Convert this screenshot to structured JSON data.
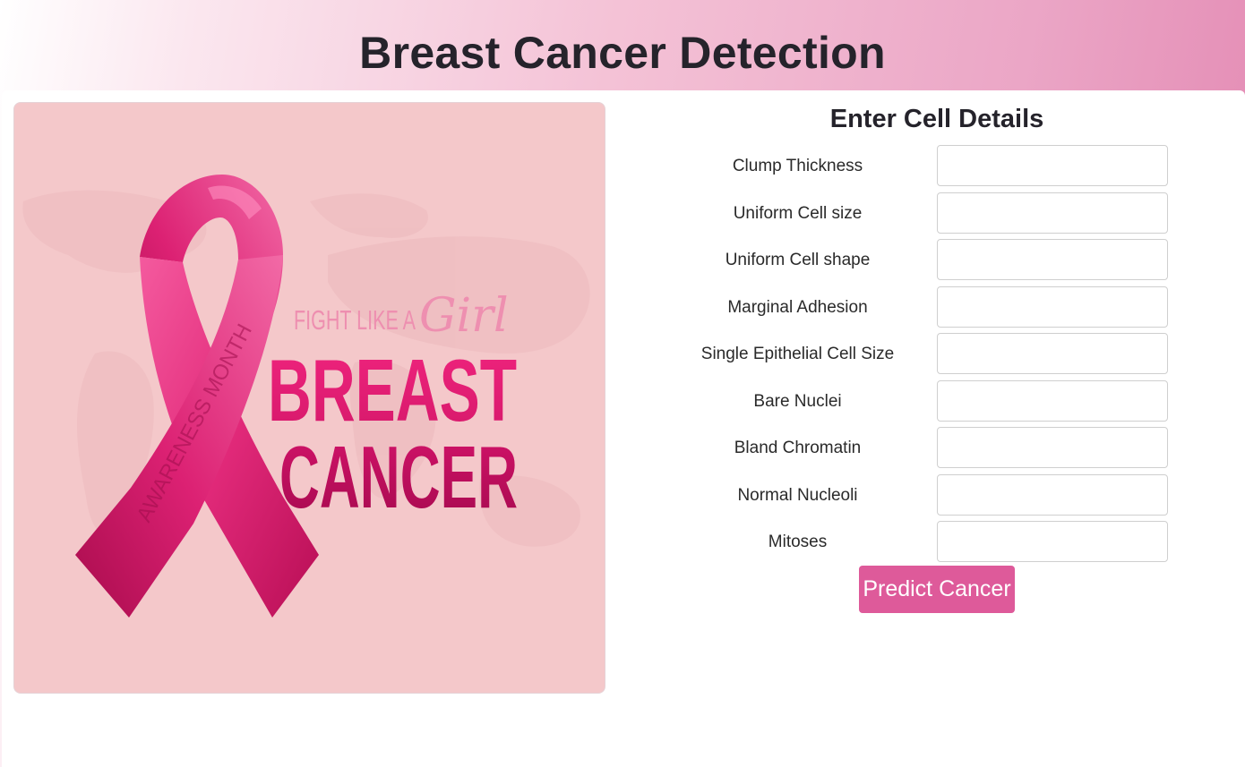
{
  "header": {
    "title": "Breast Cancer Detection"
  },
  "image": {
    "alt": "Breast cancer awareness ribbon illustration",
    "ribbon_text": "AWARENESS MONTH",
    "line1_prefix": "FIGHT LIKE A",
    "line1_script": "Girl",
    "line2": "BREAST",
    "line3": "CANCER"
  },
  "form": {
    "heading": "Enter Cell Details",
    "fields": [
      {
        "label": "Clump Thickness",
        "value": "",
        "placeholder": ""
      },
      {
        "label": "Uniform Cell size",
        "value": "",
        "placeholder": ""
      },
      {
        "label": "Uniform Cell shape",
        "value": "",
        "placeholder": ""
      },
      {
        "label": "Marginal Adhesion",
        "value": "",
        "placeholder": ""
      },
      {
        "label": "Single Epithelial Cell Size",
        "value": "",
        "placeholder": ""
      },
      {
        "label": "Bare Nuclei",
        "value": "",
        "placeholder": ""
      },
      {
        "label": "Bland Chromatin",
        "value": "",
        "placeholder": ""
      },
      {
        "label": "Normal Nucleoli",
        "value": "",
        "placeholder": ""
      },
      {
        "label": "Mitoses",
        "value": "",
        "placeholder": ""
      }
    ],
    "submit_label": "Predict Cancer"
  },
  "colors": {
    "accent": "#de5a9a",
    "image_background": "#f4c8ca",
    "ribbon": "#e62a7c",
    "heading_text": "#25232b"
  }
}
